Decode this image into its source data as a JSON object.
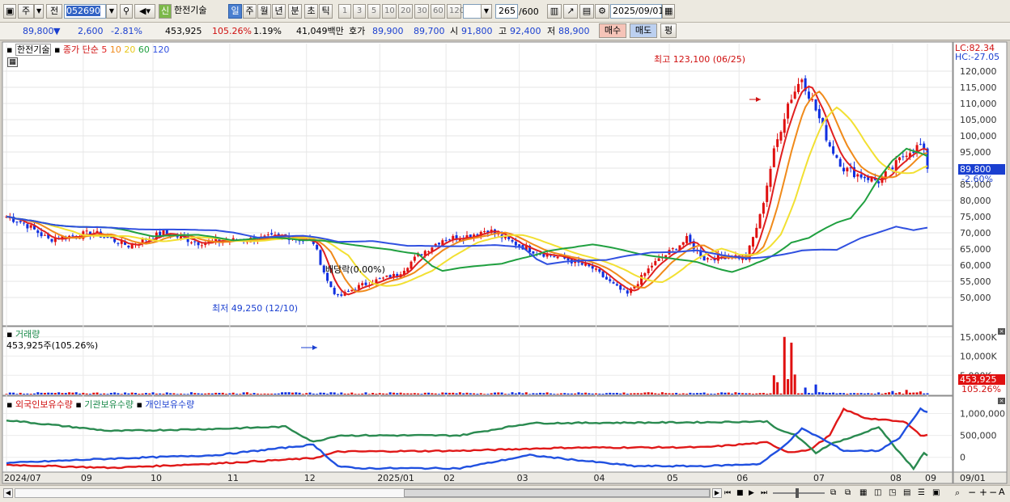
{
  "toolbar": {
    "mode": "주",
    "prev": "전",
    "code": "052690",
    "sin_badge": "신",
    "stock_name": "한전기술",
    "periods": [
      "일",
      "주",
      "월",
      "년",
      "분",
      "초",
      "틱"
    ],
    "intervals": [
      "1",
      "3",
      "5",
      "10",
      "20",
      "30",
      "60",
      "120"
    ],
    "count": "265",
    "count_total": "/600",
    "date": "2025/09/01"
  },
  "quote": {
    "price": "89,800",
    "down_arrow": "▼",
    "change": "2,600",
    "change_pct": "-2.81%",
    "volume": "453,925",
    "volume_ratio": "105.26%",
    "turnover": "1.19%",
    "amount": "41,049백만",
    "hoga_label": "호가",
    "hoga1": "89,900",
    "hoga2": "89,700",
    "open_label": "시",
    "open": "91,800",
    "high_label": "고",
    "high": "92,400",
    "low_label": "저",
    "low": "88,900",
    "buy": "매수",
    "sell": "매도",
    "eval": "평"
  },
  "legend": {
    "name": "한전기술",
    "price_label": "종가",
    "ma_type": "단순",
    "ma5": "5",
    "ma10": "10",
    "ma20": "20",
    "ma60": "60",
    "ma120": "120"
  },
  "right_info": {
    "lc": "LC:82.34",
    "hc": "HC:-27.05",
    "price_tag": "89,800",
    "pct_tag": "-2.60%",
    "vol_tag": "453,925",
    "vol_pct_tag": "105.26%"
  },
  "annotations": {
    "high": "최고 123,100 (06/25)",
    "low": "최저 49,250 (12/10)",
    "dividend": "배당락(0.00%)"
  },
  "volume_panel": {
    "title": "거래량",
    "info": "453,925주(105.26%)"
  },
  "holdings_panel": {
    "foreign": "외국인보유수량",
    "inst": "기관보유수량",
    "indiv": "개인보유수량"
  },
  "x_labels": [
    "2024/07",
    "09",
    "10",
    "11",
    "12",
    "2025/01",
    "02",
    "03",
    "04",
    "05",
    "06",
    "07",
    "08",
    "09"
  ],
  "x_right": "09/01",
  "colors": {
    "up": "#e01010",
    "down": "#1030e0",
    "ma5": "#e02020",
    "ma10": "#f08a1a",
    "ma20": "#f2e032",
    "ma60": "#20a040",
    "ma120": "#3050e0",
    "foreign": "#e01818",
    "inst": "#2a8a50",
    "indiv": "#2050e0"
  },
  "chart_data": [
    {
      "type": "candlestick",
      "title": "한전기술",
      "ylim": [
        45000,
        125000
      ],
      "y_ticks": [
        "50,000",
        "55,000",
        "60,000",
        "65,000",
        "70,000",
        "75,000",
        "80,000",
        "85,000",
        "90,000",
        "95,000",
        "100,000",
        "105,000",
        "110,000",
        "115,000",
        "120,000"
      ],
      "close_anchors": [
        [
          0,
          75000
        ],
        [
          5,
          73000
        ],
        [
          12,
          68000
        ],
        [
          25,
          70000
        ],
        [
          35,
          66000
        ],
        [
          45,
          70000
        ],
        [
          55,
          67000
        ],
        [
          70,
          68000
        ],
        [
          80,
          69000
        ],
        [
          88,
          67000
        ],
        [
          92,
          55000
        ],
        [
          95,
          50000
        ],
        [
          100,
          53000
        ],
        [
          105,
          55000
        ],
        [
          112,
          57000
        ],
        [
          118,
          63000
        ],
        [
          125,
          68000
        ],
        [
          132,
          69000
        ],
        [
          138,
          71000
        ],
        [
          145,
          67000
        ],
        [
          152,
          64000
        ],
        [
          160,
          62000
        ],
        [
          168,
          59000
        ],
        [
          175,
          53000
        ],
        [
          178,
          51000
        ],
        [
          185,
          60000
        ],
        [
          190,
          64000
        ],
        [
          195,
          68000
        ],
        [
          200,
          62000
        ],
        [
          208,
          63000
        ],
        [
          212,
          62000
        ],
        [
          216,
          75000
        ],
        [
          220,
          95000
        ],
        [
          224,
          110000
        ],
        [
          228,
          118000
        ],
        [
          232,
          108000
        ],
        [
          236,
          97000
        ],
        [
          240,
          90000
        ],
        [
          244,
          88000
        ],
        [
          250,
          86000
        ],
        [
          254,
          90000
        ],
        [
          258,
          95000
        ],
        [
          262,
          97000
        ],
        [
          264,
          92000
        ],
        [
          265,
          89800
        ]
      ],
      "ma_periods": [
        5,
        10,
        20,
        60,
        120
      ]
    },
    {
      "type": "bar",
      "title": "거래량",
      "ylim": [
        0,
        16000
      ],
      "units": "K",
      "y_ticks": [
        "5,000K",
        "10,000K",
        "15,000K"
      ],
      "spikes": [
        [
          220,
          5000
        ],
        [
          221,
          3200
        ],
        [
          223,
          15000
        ],
        [
          224,
          4000
        ],
        [
          225,
          13500
        ],
        [
          226,
          5200
        ],
        [
          229,
          1800
        ],
        [
          232,
          2600
        ],
        [
          254,
          900
        ],
        [
          258,
          1200
        ],
        [
          262,
          800
        ]
      ]
    },
    {
      "type": "line",
      "title": "보유수량",
      "ylim": [
        -300000,
        1250000
      ],
      "y_ticks": [
        "0",
        "500,000",
        "1,000,000"
      ],
      "series": [
        {
          "name": "외국인보유수량",
          "anchors": [
            [
              0,
              -170000
            ],
            [
              30,
              -240000
            ],
            [
              60,
              -140000
            ],
            [
              88,
              -20000
            ],
            [
              95,
              130000
            ],
            [
              130,
              150000
            ],
            [
              160,
              220000
            ],
            [
              200,
              230000
            ],
            [
              218,
              340000
            ],
            [
              224,
              120000
            ],
            [
              230,
              160000
            ],
            [
              236,
              500000
            ],
            [
              240,
              1100000
            ],
            [
              246,
              900000
            ],
            [
              252,
              850000
            ],
            [
              258,
              800000
            ],
            [
              262,
              500000
            ],
            [
              265,
              500000
            ]
          ]
        },
        {
          "name": "기관보유수량",
          "anchors": [
            [
              0,
              850000
            ],
            [
              30,
              600000
            ],
            [
              60,
              650000
            ],
            [
              80,
              700000
            ],
            [
              88,
              350000
            ],
            [
              95,
              500000
            ],
            [
              130,
              500000
            ],
            [
              150,
              780000
            ],
            [
              200,
              800000
            ],
            [
              218,
              820000
            ],
            [
              222,
              600000
            ],
            [
              226,
              520000
            ],
            [
              232,
              100000
            ],
            [
              236,
              300000
            ],
            [
              244,
              500000
            ],
            [
              250,
              700000
            ],
            [
              256,
              100000
            ],
            [
              260,
              -250000
            ],
            [
              263,
              100000
            ],
            [
              265,
              0
            ]
          ]
        },
        {
          "name": "개인보유수량",
          "anchors": [
            [
              0,
              -130000
            ],
            [
              30,
              -30000
            ],
            [
              60,
              50000
            ],
            [
              88,
              290000
            ],
            [
              95,
              -200000
            ],
            [
              100,
              -250000
            ],
            [
              130,
              -250000
            ],
            [
              150,
              50000
            ],
            [
              180,
              -200000
            ],
            [
              200,
              -200000
            ],
            [
              216,
              -150000
            ],
            [
              222,
              200000
            ],
            [
              228,
              650000
            ],
            [
              232,
              500000
            ],
            [
              240,
              150000
            ],
            [
              250,
              150000
            ],
            [
              256,
              450000
            ],
            [
              262,
              1100000
            ],
            [
              265,
              1000000
            ]
          ]
        }
      ]
    }
  ]
}
